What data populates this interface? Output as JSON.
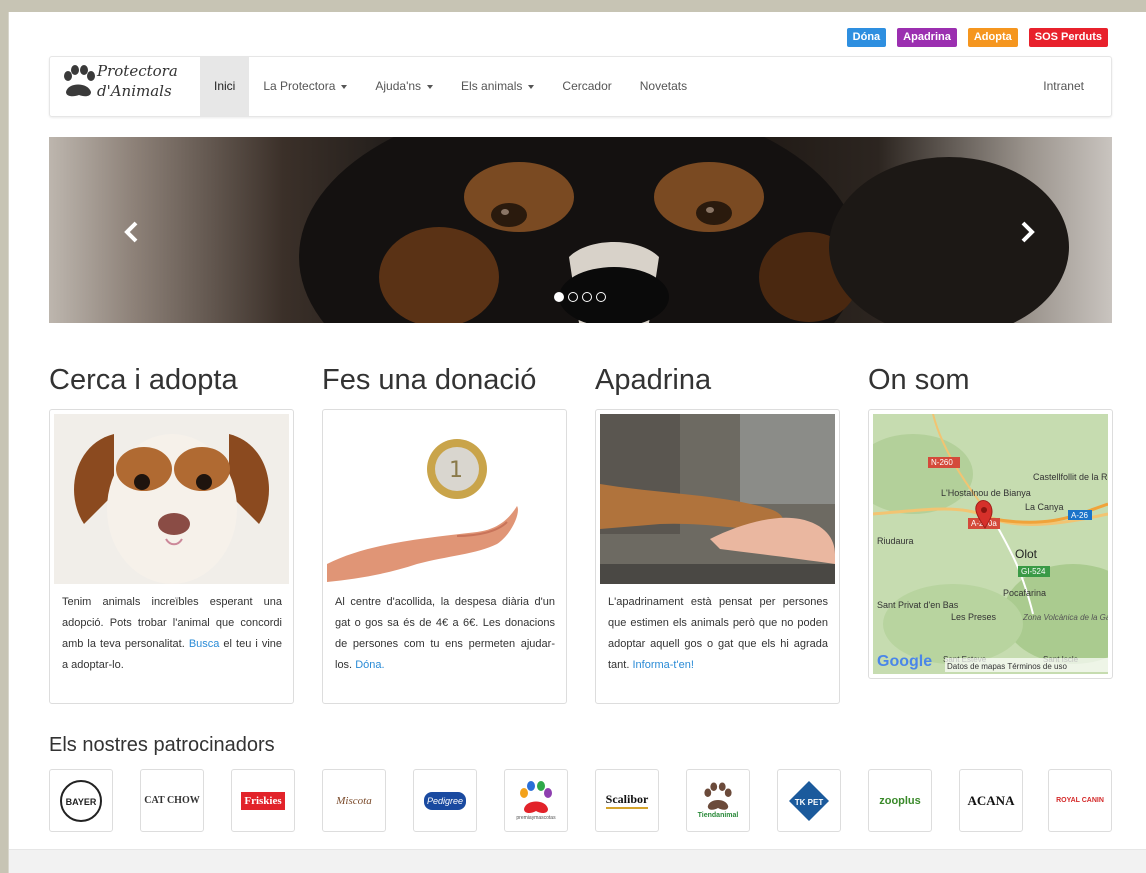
{
  "quick_links": [
    {
      "label": "Dóna",
      "color": "#2e8fe0"
    },
    {
      "label": "Apadrina",
      "color": "#9b2fb0"
    },
    {
      "label": "Adopta",
      "color": "#f5961f"
    },
    {
      "label": "SOS Perduts",
      "color": "#e8212c"
    }
  ],
  "brand": {
    "line1": "Protectora",
    "line2": "d'Animals"
  },
  "nav": {
    "items": [
      {
        "label": "Inici"
      },
      {
        "label": "La Protectora"
      },
      {
        "label": "Ajuda'ns"
      },
      {
        "label": "Els animals"
      },
      {
        "label": "Cercador"
      },
      {
        "label": "Novetats"
      }
    ],
    "intranet": "Intranet"
  },
  "carousel": {
    "prev": "‹",
    "next": "›",
    "slides": 4,
    "active": 1
  },
  "columns": [
    {
      "title": "Cerca i adopta",
      "text": "Tenim animals increïbles esperant una adopció. Pots trobar l'animal que concordi amb la teva personalitat. ",
      "link": "Busca",
      "text_after": " el teu i vine a adoptar-lo."
    },
    {
      "title": "Fes una donació",
      "text": "Al centre d'acollida, la despesa diària d'un gat o gos sa és de 4€ a 6€. Les donacions de persones com tu ens permeten ajudar-los. ",
      "link": "Dóna.",
      "text_after": ""
    },
    {
      "title": "Apadrina",
      "text": "L'apadrinament està pensat per persones que estimen els animals però que no poden adoptar aquell gos o gat que els hi agrada tant. ",
      "link": "Informa-t'en!",
      "text_after": ""
    },
    {
      "title": "On som"
    }
  ],
  "map": {
    "labels": [
      "N-260",
      "L'Hostalnou de Bianya",
      "La Canya",
      "A-26",
      "Castellfollit de la Roca",
      "Riudaura",
      "Olot",
      "GI-524",
      "Pocafarina",
      "Sant Privat d'en Bas",
      "Les Preses",
      "Zona Volcànica de la Garrotxa",
      "Sant Esteve",
      "Sant Iscle",
      "A-260a"
    ],
    "google": "Google",
    "footer": "Datos de mapas   Términos de uso"
  },
  "sponsors": {
    "title": "Els nostres patrocinadors",
    "items": [
      "BAYER",
      "CAT CHOW",
      "Friskies",
      "Miscota",
      "Pedigree",
      "premiaymascotas",
      "Scalibor",
      "Tiendanimal",
      "TK PET",
      "zooplus",
      "ACANA",
      "ROYAL CANIN"
    ]
  }
}
